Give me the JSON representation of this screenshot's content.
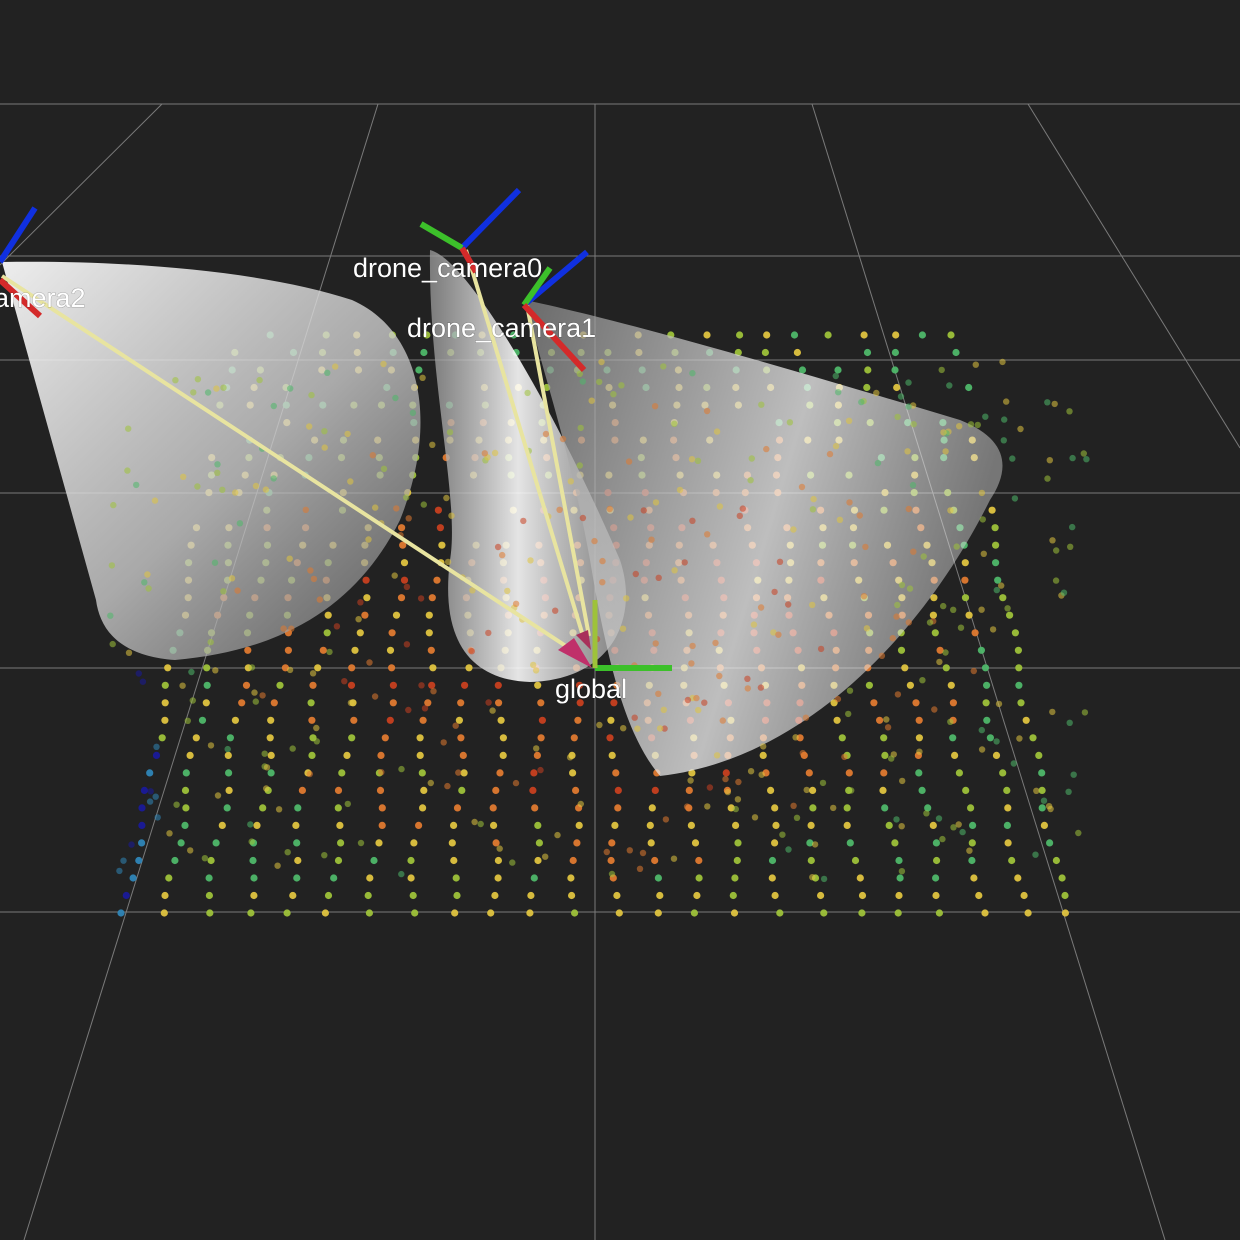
{
  "scene": {
    "background_color": "#222222",
    "grid_color": "#8a8a8a",
    "frames": [
      {
        "id": "drone_camera2",
        "label": "amera2"
      },
      {
        "id": "drone_camera0",
        "label": "drone_camera0"
      },
      {
        "id": "drone_camera1",
        "label": "drone_camera1"
      },
      {
        "id": "global",
        "label": "global"
      }
    ],
    "axis_colors": {
      "x": "#d42a2a",
      "y": "#3cc02a",
      "z": "#1030e0"
    },
    "tf_arrow_color": "#e8e4a0",
    "tf_arrowhead_color": "#c0306a",
    "cone_color": "#e8e8e8",
    "point_cloud_colormap": [
      "#1a1a9a",
      "#2f86b8",
      "#4fb86a",
      "#9ec23a",
      "#e0c440",
      "#e07a30",
      "#c84020"
    ]
  }
}
